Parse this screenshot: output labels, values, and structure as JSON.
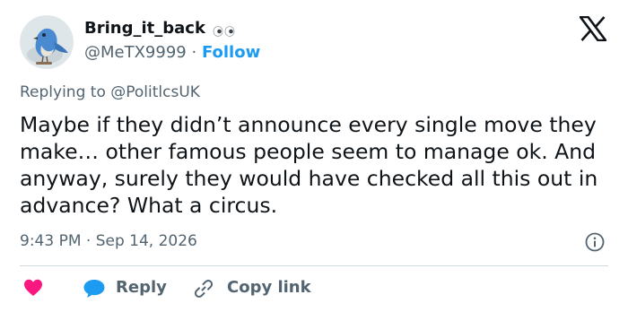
{
  "author": {
    "display_name": "Bring_it_back",
    "name_icon": "eyes-icon",
    "handle": "@MeTX9999",
    "separator": "·",
    "follow_label": "Follow",
    "avatar_icon": "bluebird-avatar"
  },
  "platform_logo": "x-logo-icon",
  "reply_context": {
    "prefix": "Replying to",
    "mention": "@PolitlcsUK"
  },
  "post": {
    "text": "Maybe if they didn’t announce every single move they make… other famous people seem to manage ok. And anyway, surely they would have checked all this out in advance? What a circus.",
    "timestamp": "9:43 PM · Sep 14, 2026"
  },
  "actions": {
    "like_icon": "heart-icon",
    "reply_label": "Reply",
    "reply_icon": "reply-bubble-icon",
    "copy_link_label": "Copy link",
    "copy_link_icon": "link-icon",
    "info_icon": "info-icon"
  },
  "colors": {
    "text": "#0f1419",
    "secondary": "#536471",
    "accent": "#1d9bf0",
    "like": "#f91880",
    "divider": "#cfd9de"
  }
}
